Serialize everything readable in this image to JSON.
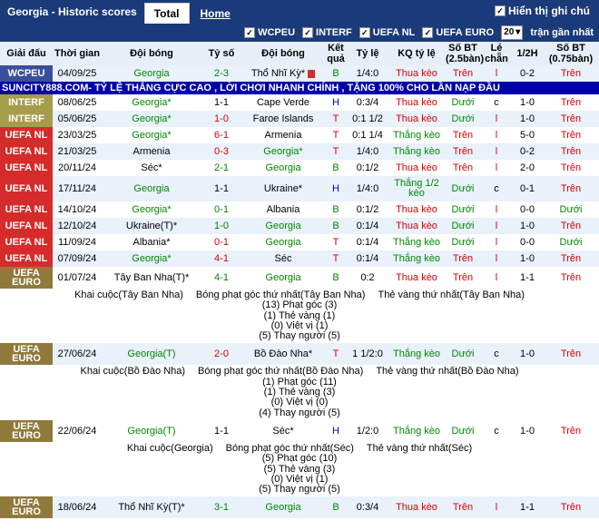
{
  "header": {
    "title": "Georgia - Historic scores",
    "tabs": [
      {
        "label": "Total"
      },
      {
        "label": "Home"
      }
    ],
    "show_notes": "Hiển thị ghi chú"
  },
  "filters": {
    "items": [
      "WCPEU",
      "INTERF",
      "UEFA NL",
      "UEFA EURO"
    ],
    "count": "20",
    "suffix": "trận gần nhất"
  },
  "columns": [
    "Giải đấu",
    "Thời gian",
    "Đội bóng",
    "Tỷ số",
    "Đội bóng",
    "Kết quả",
    "Tỷ lệ",
    "KQ tỷ lệ",
    "Số BT (2.5bàn)",
    "Lẻ chẵn",
    "1/2H",
    "Số BT (0.75bàn)"
  ],
  "ad": "SUNCITY888.COM- TỶ LỆ THẮNG CỰC CAO , LỜI CHƠI NHANH CHÍNH , TẶNG 100% CHO LẦN NẠP ĐẦU",
  "rows": [
    {
      "comp": "WCPEU",
      "date": "04/09/25",
      "home": "Georgia",
      "score": "2-3",
      "away": "Thổ Nhĩ Kỳ*",
      "res": "B",
      "odds": "1/4:0",
      "kq": "Thua kèo",
      "bt": "Trên",
      "lc": "l",
      "h1": "0-2",
      "bt2": "Trên"
    },
    {
      "comp": "INTERF",
      "date": "08/06/25",
      "home": "Georgia*",
      "score": "1-1",
      "away": "Cape Verde",
      "res": "H",
      "odds": "0:3/4",
      "kq": "Thua kèo",
      "bt": "Dưới",
      "lc": "c",
      "h1": "1-0",
      "bt2": "Trên"
    },
    {
      "comp": "INTERF",
      "date": "05/06/25",
      "home": "Georgia*",
      "score": "1-0",
      "away": "Faroe Islands",
      "res": "T",
      "odds": "0:1 1/2",
      "kq": "Thua kèo",
      "bt": "Dưới",
      "lc": "l",
      "h1": "1-0",
      "bt2": "Trên"
    },
    {
      "comp": "UEFA NL",
      "date": "23/03/25",
      "home": "Georgia*",
      "score": "6-1",
      "away": "Armenia",
      "res": "T",
      "odds": "0:1 1/4",
      "kq": "Thắng kèo",
      "bt": "Trên",
      "lc": "l",
      "h1": "5-0",
      "bt2": "Trên"
    },
    {
      "comp": "UEFA NL",
      "date": "21/03/25",
      "home": "Armenia",
      "score": "0-3",
      "away": "Georgia*",
      "res": "T",
      "odds": "1/4:0",
      "kq": "Thắng kèo",
      "bt": "Trên",
      "lc": "l",
      "h1": "0-2",
      "bt2": "Trên"
    },
    {
      "comp": "UEFA NL",
      "date": "20/11/24",
      "home": "Séc*",
      "score": "2-1",
      "away": "Georgia",
      "res": "B",
      "odds": "0:1/2",
      "kq": "Thua kèo",
      "bt": "Trên",
      "lc": "l",
      "h1": "2-0",
      "bt2": "Trên"
    },
    {
      "comp": "UEFA NL",
      "date": "17/11/24",
      "home": "Georgia",
      "score": "1-1",
      "away": "Ukraine*",
      "res": "H",
      "odds": "1/4:0",
      "kq": "Thắng 1/2 kèo",
      "bt": "Dưới",
      "lc": "c",
      "h1": "0-1",
      "bt2": "Trên"
    },
    {
      "comp": "UEFA NL",
      "date": "14/10/24",
      "home": "Georgia*",
      "score": "0-1",
      "away": "Albania",
      "res": "B",
      "odds": "0:1/2",
      "kq": "Thua kèo",
      "bt": "Dưới",
      "lc": "l",
      "h1": "0-0",
      "bt2": "Dưới"
    },
    {
      "comp": "UEFA NL",
      "date": "12/10/24",
      "home": "Ukraine(T)*",
      "score": "1-0",
      "away": "Georgia",
      "res": "B",
      "odds": "0:1/4",
      "kq": "Thua kèo",
      "bt": "Dưới",
      "lc": "l",
      "h1": "1-0",
      "bt2": "Trên"
    },
    {
      "comp": "UEFA NL",
      "date": "11/09/24",
      "home": "Albania*",
      "score": "0-1",
      "away": "Georgia",
      "res": "T",
      "odds": "0:1/4",
      "kq": "Thắng kèo",
      "bt": "Dưới",
      "lc": "l",
      "h1": "0-0",
      "bt2": "Dưới"
    },
    {
      "comp": "UEFA NL",
      "date": "07/09/24",
      "home": "Georgia*",
      "score": "4-1",
      "away": "Séc",
      "res": "T",
      "odds": "0:1/4",
      "kq": "Thắng kèo",
      "bt": "Trên",
      "lc": "l",
      "h1": "1-0",
      "bt2": "Trên"
    },
    {
      "comp": "UEFA EURO",
      "date": "01/07/24",
      "home": "Tây Ban Nha(T)*",
      "score": "4-1",
      "away": "Georgia",
      "res": "B",
      "odds": "0:2",
      "kq": "Thua kèo",
      "bt": "Trên",
      "lc": "l",
      "h1": "1-1",
      "bt2": "Trên"
    },
    {
      "comp": "UEFA EURO",
      "date": "27/06/24",
      "home": "Georgia(T)",
      "score": "2-0",
      "away": "Bồ Đào Nha*",
      "res": "T",
      "odds": "1 1/2:0",
      "kq": "Thắng kèo",
      "bt": "Dưới",
      "lc": "c",
      "h1": "1-0",
      "bt2": "Trên"
    },
    {
      "comp": "UEFA EURO",
      "date": "22/06/24",
      "home": "Georgia(T)",
      "score": "1-1",
      "away": "Séc*",
      "res": "H",
      "odds": "1/2:0",
      "kq": "Thắng kèo",
      "bt": "Dưới",
      "lc": "c",
      "h1": "1-0",
      "bt2": "Trên"
    },
    {
      "comp": "UEFA EURO",
      "date": "18/06/24",
      "home": "Thổ Nhĩ Kỳ(T)*",
      "score": "3-1",
      "away": "Georgia",
      "res": "B",
      "odds": "0:3/4",
      "kq": "Thua kèo",
      "bt": "Trên",
      "lc": "l",
      "h1": "1-1",
      "bt2": "Trên"
    }
  ],
  "details": [
    {
      "l1a": "Khai cuộc(Tây Ban Nha)",
      "l1b": "Bóng phạt góc thứ nhất(Tây Ban Nha)",
      "l1c": "Thẻ vàng thứ nhất(Tây Ban Nha)",
      "l2": "(13) Phạt góc (3)",
      "l3": "(1) Thẻ vàng (1)",
      "l4": "(0) Việt vị (1)",
      "l5": "(5) Thay người (5)"
    },
    {
      "l1a": "Khai cuộc(Bồ Đào Nha)",
      "l1b": "Bóng phạt góc thứ nhất(Bồ Đào Nha)",
      "l1c": "Thẻ vàng thứ nhất(Bồ Đào Nha)",
      "l2": "(1) Phạt góc (11)",
      "l3": "(1) Thẻ vàng (3)",
      "l4": "(0) Việt vị (0)",
      "l5": "(4) Thay người (5)"
    },
    {
      "l1a": "Khai cuộc(Georgia)",
      "l1b": "Bóng phạt góc thứ nhất(Séc)",
      "l1c": "Thẻ vàng thứ nhất(Séc)",
      "l2": "(5) Phạt góc (10)",
      "l3": "(5) Thẻ vàng (3)",
      "l4": "(0) Việt vị (1)",
      "l5": "(5) Thay người (5)"
    }
  ]
}
